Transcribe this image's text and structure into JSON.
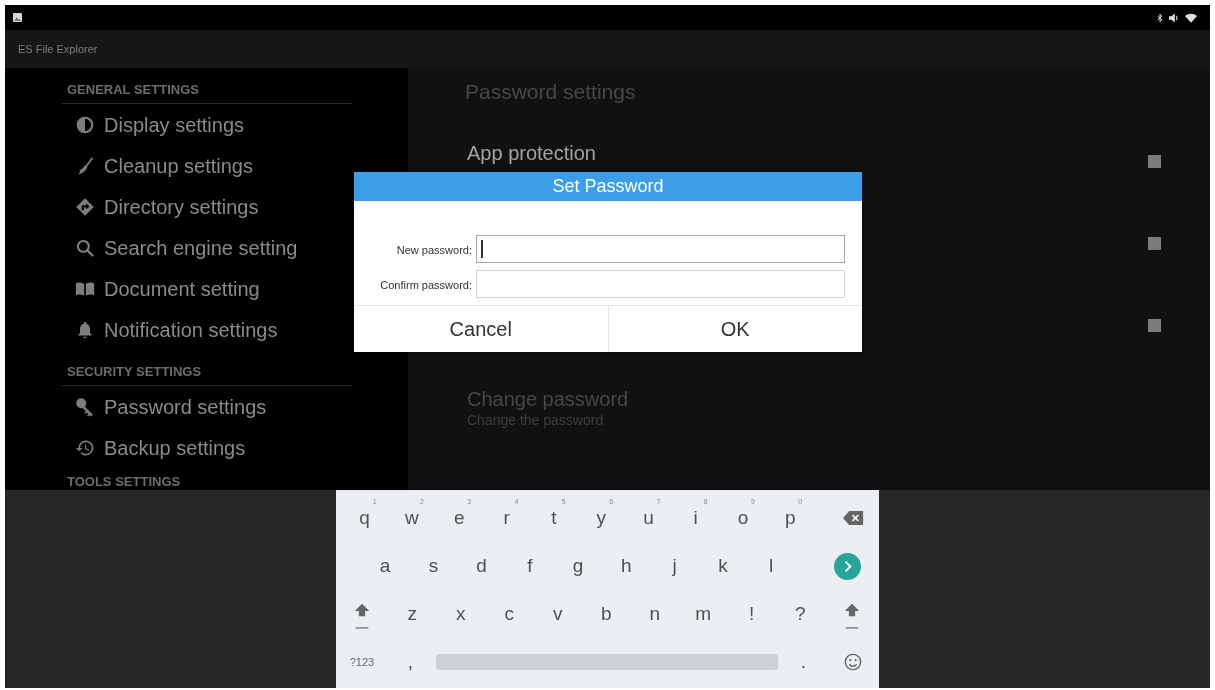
{
  "app_bar": {
    "title": "ES File Explorer"
  },
  "sidebar": {
    "sections": [
      {
        "title": "GENERAL SETTINGS",
        "items": [
          {
            "label": "Display settings"
          },
          {
            "label": "Cleanup settings"
          },
          {
            "label": "Directory settings"
          },
          {
            "label": "Search engine setting"
          },
          {
            "label": "Document setting"
          },
          {
            "label": "Notification settings"
          }
        ]
      },
      {
        "title": "SECURITY SETTINGS",
        "items": [
          {
            "label": "Password settings"
          },
          {
            "label": "Backup settings"
          }
        ]
      },
      {
        "title": "TOOLS SETTINGS"
      }
    ]
  },
  "preferences": {
    "title": "Password settings",
    "items": [
      {
        "kind": "checkbox",
        "title": "App protection",
        "checked": false,
        "disabled": false
      },
      {
        "kind": "checkbox",
        "checked": false,
        "disabled": false
      },
      {
        "kind": "checkbox",
        "checked": false,
        "disabled": false
      },
      {
        "kind": "action",
        "title": "Change password",
        "subtitle": "Change the password",
        "disabled": true
      }
    ]
  },
  "dialog": {
    "title": "Set Password",
    "fields": [
      {
        "label": "New password:",
        "focused": true
      },
      {
        "label": "Confirm password:",
        "focused": false
      }
    ],
    "buttons": [
      "Cancel",
      "OK"
    ]
  },
  "keyboard": {
    "rows": [
      [
        {
          "kind": "char",
          "label": "q",
          "hint": "1"
        },
        {
          "kind": "char",
          "label": "w",
          "hint": "2"
        },
        {
          "kind": "char",
          "label": "e",
          "hint": "3"
        },
        {
          "kind": "char",
          "label": "r",
          "hint": "4"
        },
        {
          "kind": "char",
          "label": "t",
          "hint": "5"
        },
        {
          "kind": "char",
          "label": "y",
          "hint": "6"
        },
        {
          "kind": "char",
          "label": "u",
          "hint": "7"
        },
        {
          "kind": "char",
          "label": "i",
          "hint": "8"
        },
        {
          "kind": "char",
          "label": "o",
          "hint": "9"
        },
        {
          "kind": "char",
          "label": "p",
          "hint": "0"
        },
        {
          "kind": "backspace"
        }
      ],
      [
        {
          "kind": "char",
          "label": "a"
        },
        {
          "kind": "char",
          "label": "s"
        },
        {
          "kind": "char",
          "label": "d"
        },
        {
          "kind": "char",
          "label": "f"
        },
        {
          "kind": "char",
          "label": "g"
        },
        {
          "kind": "char",
          "label": "h"
        },
        {
          "kind": "char",
          "label": "j"
        },
        {
          "kind": "char",
          "label": "k"
        },
        {
          "kind": "char",
          "label": "l"
        },
        {
          "kind": "go"
        }
      ],
      [
        {
          "kind": "shift"
        },
        {
          "kind": "char",
          "label": "z"
        },
        {
          "kind": "char",
          "label": "x"
        },
        {
          "kind": "char",
          "label": "c"
        },
        {
          "kind": "char",
          "label": "v"
        },
        {
          "kind": "char",
          "label": "b"
        },
        {
          "kind": "char",
          "label": "n"
        },
        {
          "kind": "char",
          "label": "m"
        },
        {
          "kind": "char",
          "label": "!"
        },
        {
          "kind": "char",
          "label": "?"
        },
        {
          "kind": "shift"
        }
      ],
      [
        {
          "kind": "mode",
          "label": "?123"
        },
        {
          "kind": "char",
          "label": ","
        },
        {
          "kind": "space"
        },
        {
          "kind": "char",
          "label": "."
        },
        {
          "kind": "emoji"
        }
      ]
    ]
  }
}
